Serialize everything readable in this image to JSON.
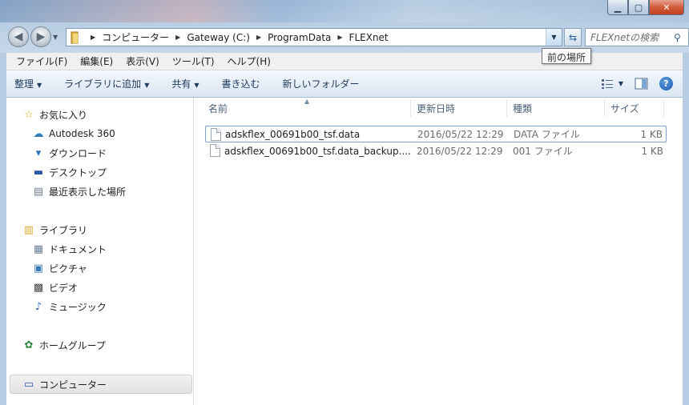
{
  "address": {
    "crumbs": [
      "コンピューター",
      "Gateway (C:)",
      "ProgramData",
      "FLEXnet"
    ]
  },
  "search": {
    "placeholder": "FLEXnetの検索"
  },
  "tooltip": "前の場所",
  "menu": [
    "ファイル(F)",
    "編集(E)",
    "表示(V)",
    "ツール(T)",
    "ヘルプ(H)"
  ],
  "commands": {
    "organize": "整理",
    "add_to_library": "ライブラリに追加",
    "share": "共有",
    "burn": "書き込む",
    "new_folder": "新しいフォルダー"
  },
  "nav": {
    "favorites": "お気に入り",
    "autodesk": "Autodesk 360",
    "downloads": "ダウンロード",
    "desktop": "デスクトップ",
    "recent": "最近表示した場所",
    "libraries": "ライブラリ",
    "documents": "ドキュメント",
    "pictures": "ピクチャ",
    "videos": "ビデオ",
    "music": "ミュージック",
    "homegroup": "ホームグループ",
    "computer": "コンピューター"
  },
  "columns": {
    "name": "名前",
    "modified": "更新日時",
    "type": "種類",
    "size": "サイズ"
  },
  "files": [
    {
      "name": "adskflex_00691b00_tsf.data",
      "modified": "2016/05/22 12:29",
      "type": "DATA ファイル",
      "size": "1 KB"
    },
    {
      "name": "adskflex_00691b00_tsf.data_backup....",
      "modified": "2016/05/22 12:29",
      "type": "001 ファイル",
      "size": "1 KB"
    }
  ]
}
